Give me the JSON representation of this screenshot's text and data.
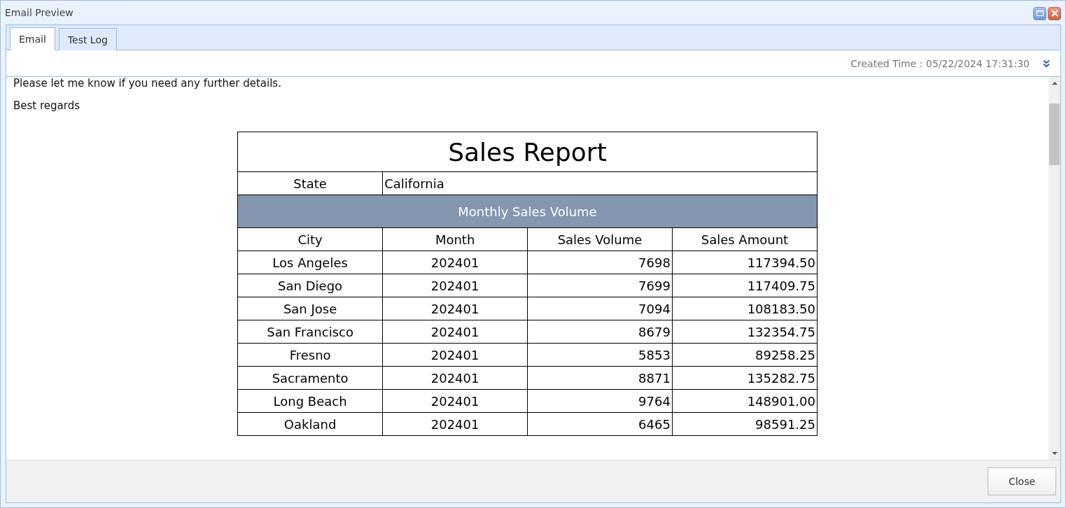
{
  "window": {
    "title": "Email Preview"
  },
  "tabs": [
    {
      "label": "Email",
      "selected": true
    },
    {
      "label": "Test Log",
      "selected": false
    }
  ],
  "created_time": "Created Time : 05/22/2024 17:31:30",
  "email": {
    "lines": [
      "Please let me know if you need any further details.",
      "Best regards"
    ],
    "report": {
      "title": "Sales Report",
      "state_label": "State",
      "state_value": "California",
      "section": "Monthly Sales Volume",
      "columns": [
        "City",
        "Month",
        "Sales Volume",
        "Sales Amount"
      ],
      "rows": [
        [
          "Los Angeles",
          "202401",
          "7698",
          "117394.50"
        ],
        [
          "San Diego",
          "202401",
          "7699",
          "117409.75"
        ],
        [
          "San Jose",
          "202401",
          "7094",
          "108183.50"
        ],
        [
          "San Francisco",
          "202401",
          "8679",
          "132354.75"
        ],
        [
          "Fresno",
          "202401",
          "5853",
          "89258.25"
        ],
        [
          "Sacramento",
          "202401",
          "8871",
          "135282.75"
        ],
        [
          "Long Beach",
          "202401",
          "9764",
          "148901.00"
        ],
        [
          "Oakland",
          "202401",
          "6465",
          "98591.25"
        ]
      ]
    }
  },
  "buttons": [
    "Close"
  ]
}
